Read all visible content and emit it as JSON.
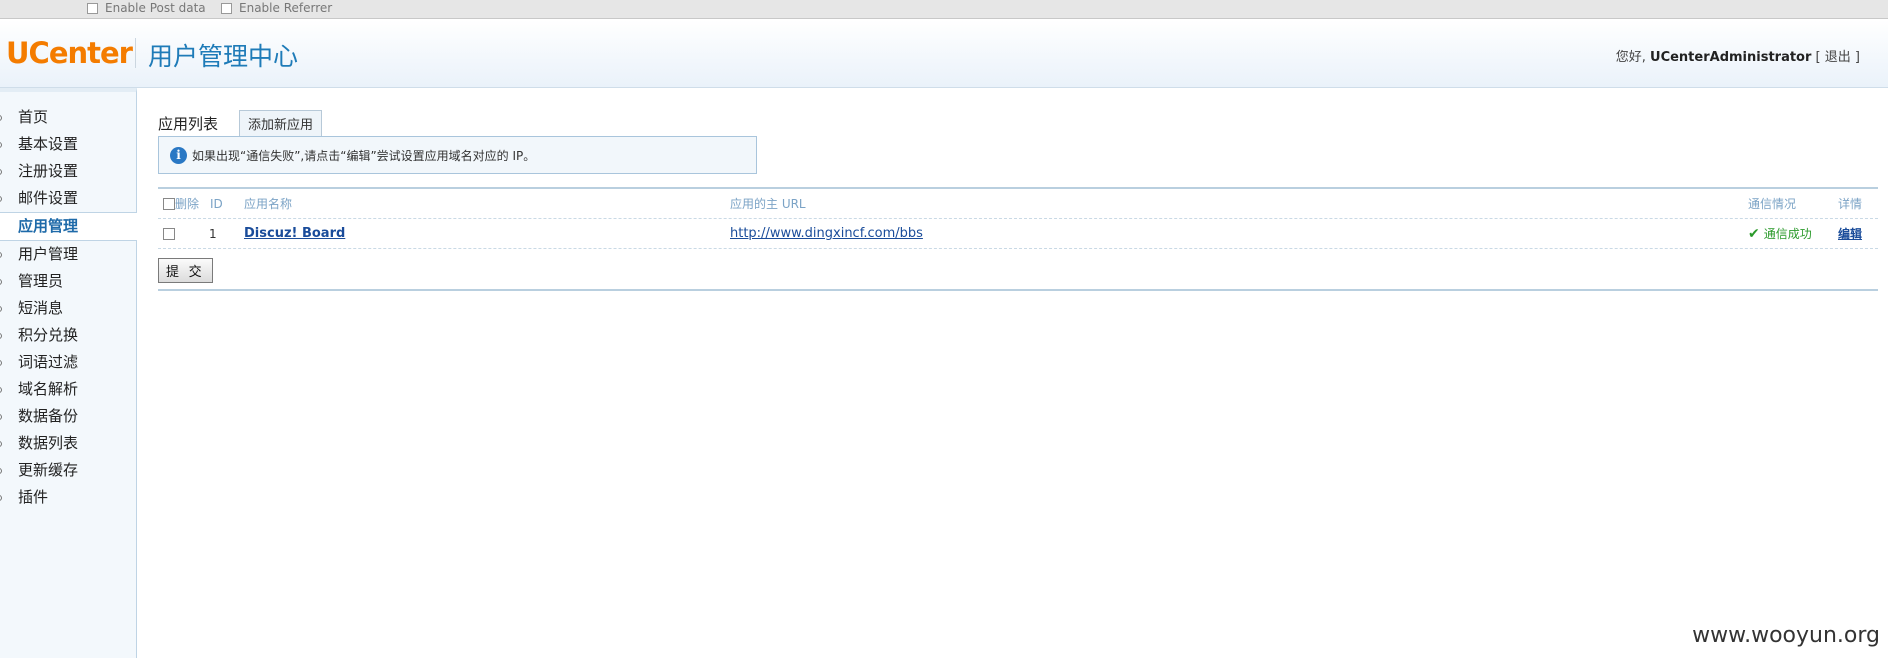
{
  "debugbar": {
    "post_data_label": "Enable Post data",
    "referrer_label": "Enable Referrer"
  },
  "header": {
    "logo": "UCenter",
    "title": "用户管理中心",
    "greeting": "您好,",
    "username": "UCenterAdministrator",
    "logout_open": "[",
    "logout_label": "退出",
    "logout_close": "]"
  },
  "sidebar": {
    "items": [
      {
        "label": "首页"
      },
      {
        "label": "基本设置"
      },
      {
        "label": "注册设置"
      },
      {
        "label": "邮件设置"
      },
      {
        "label": "应用管理",
        "active": true
      },
      {
        "label": "用户管理"
      },
      {
        "label": "管理员"
      },
      {
        "label": "短消息"
      },
      {
        "label": "积分兑换"
      },
      {
        "label": "词语过滤"
      },
      {
        "label": "域名解析"
      },
      {
        "label": "数据备份"
      },
      {
        "label": "数据列表"
      },
      {
        "label": "更新缓存"
      },
      {
        "label": "插件"
      }
    ]
  },
  "main": {
    "page_label": "应用列表",
    "add_button": "添加新应用",
    "notice": "如果出现“通信失败”,请点击“编辑”尝试设置应用域名对应的 IP。",
    "table": {
      "headers": {
        "delete": "删除",
        "id": "ID",
        "name": "应用名称",
        "url": "应用的主 URL",
        "status": "通信情况",
        "detail": "详情"
      },
      "rows": [
        {
          "id": "1",
          "name": "Discuz! Board",
          "url": "http://www.dingxincf.com/bbs",
          "status": "通信成功",
          "detail": "编辑"
        }
      ]
    },
    "submit_label": "提 交"
  },
  "watermark": "www.wooyun.org",
  "colors": {
    "brand_orange": "#f47c00",
    "title_blue": "#1e7bb8",
    "link_blue": "#1a4c9a",
    "success_green": "#2b9a2b"
  }
}
